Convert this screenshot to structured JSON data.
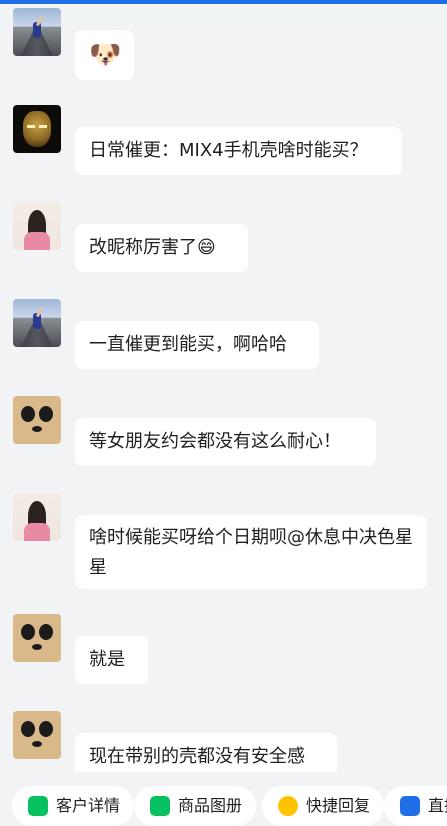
{
  "messages": [
    {
      "sender": "road",
      "text": "🐶"
    },
    {
      "sender": "ironman",
      "text": "日常催更：MIX4手机壳啥时能买？"
    },
    {
      "sender": "girl",
      "text": "改昵称厉害了😄"
    },
    {
      "sender": "road",
      "text": "一直催更到能买，啊哈哈"
    },
    {
      "sender": "panda",
      "text": "等女朋友约会都没有这么耐心！"
    },
    {
      "sender": "girl",
      "text": "啥时候能买呀给个日期呗@休息中决色星星"
    },
    {
      "sender": "panda",
      "text": "就是"
    },
    {
      "sender": "panda",
      "text": "现在带别的壳都没有安全感"
    }
  ],
  "quick_actions": [
    {
      "label": "客户详情",
      "icon": "customer-icon",
      "color": "#07c160"
    },
    {
      "label": "商品图册",
      "icon": "album-icon",
      "color": "#07c160"
    },
    {
      "label": "快捷回复",
      "icon": "quick-reply-icon",
      "color": "#ffc300"
    },
    {
      "label": "直播",
      "icon": "live-icon",
      "color": "#1e6fe8"
    }
  ],
  "colors": {
    "accent": "#1e6fe8",
    "background": "#f2f3f5",
    "bubble": "#ffffff"
  }
}
